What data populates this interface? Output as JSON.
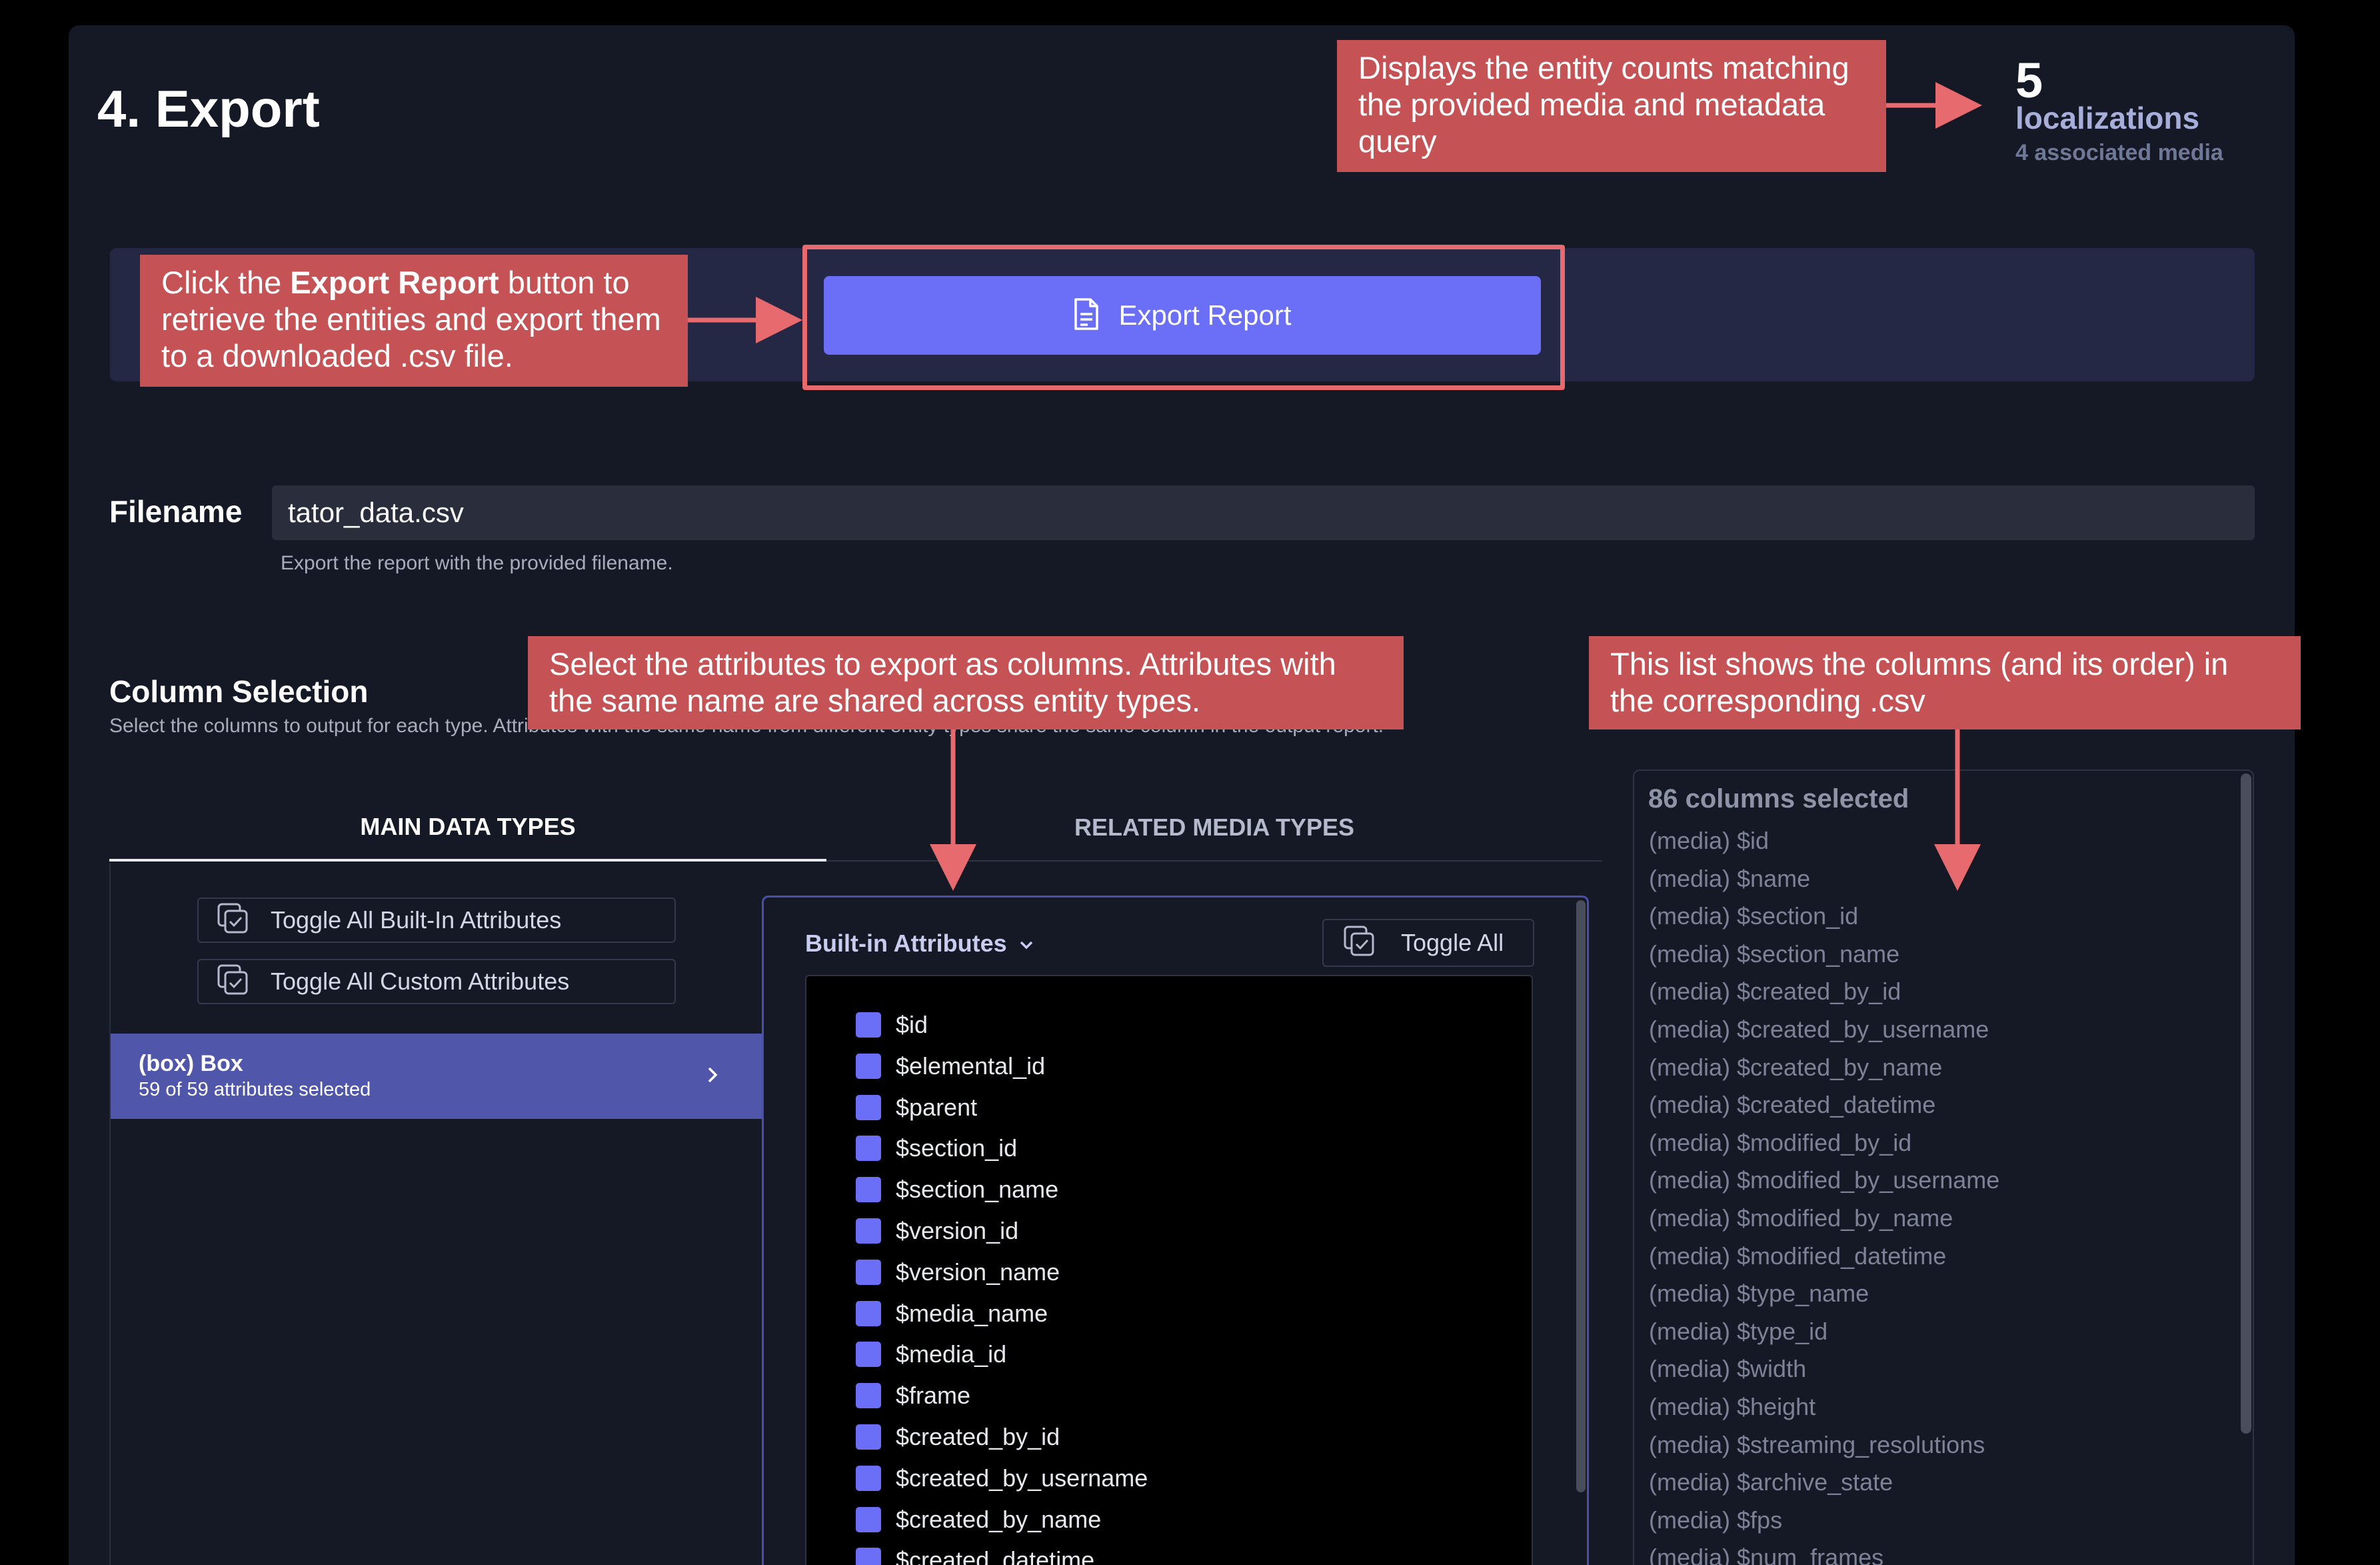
{
  "page": {
    "title": "4. Export"
  },
  "counts": {
    "number": "5",
    "label": "localizations",
    "sub": "4 associated media"
  },
  "export": {
    "button_label": "Export Report"
  },
  "filename": {
    "label": "Filename",
    "value": "tator_data.csv",
    "help": "Export the report with the provided filename."
  },
  "column_selection": {
    "title": "Column Selection",
    "description": "Select the columns to output for each type. Attributes with the same name from different entity types share the same column in the output report."
  },
  "tabs": {
    "main": "MAIN DATA TYPES",
    "related": "RELATED MEDIA TYPES"
  },
  "toggles": {
    "builtin": "Toggle All Built-In Attributes",
    "custom": "Toggle All Custom Attributes",
    "all": "Toggle All"
  },
  "box_item": {
    "name": "(box) Box",
    "sub": "59 of 59 attributes selected"
  },
  "builtin_header": "Built-in Attributes",
  "attributes": [
    "$id",
    "$elemental_id",
    "$parent",
    "$section_id",
    "$section_name",
    "$version_id",
    "$version_name",
    "$media_name",
    "$media_id",
    "$frame",
    "$created_by_id",
    "$created_by_username",
    "$created_by_name",
    "$created_datetime"
  ],
  "selected_columns": {
    "title": "86 columns selected",
    "items": [
      "(media) $id",
      "(media) $name",
      "(media) $section_id",
      "(media) $section_name",
      "(media) $created_by_id",
      "(media) $created_by_username",
      "(media) $created_by_name",
      "(media) $created_datetime",
      "(media) $modified_by_id",
      "(media) $modified_by_username",
      "(media) $modified_by_name",
      "(media) $modified_datetime",
      "(media) $type_name",
      "(media) $type_id",
      "(media) $width",
      "(media) $height",
      "(media) $streaming_resolutions",
      "(media) $archive_state",
      "(media) $fps",
      "(media) $num_frames"
    ]
  },
  "callouts": {
    "counts": "Displays the entity counts matching the provided media and metadata query",
    "export_pre": "Click the ",
    "export_bold": "Export Report",
    "export_post": " button to retrieve the entities and export them to a downloaded .csv file.",
    "attrs": "Select the attributes to export as columns. Attributes with the same name are shared across entity types.",
    "columns": "This list shows the columns (and its order) in the corresponding .csv"
  },
  "colors": {
    "accent": "#6b6ff7",
    "selected_item": "#5056a9",
    "callout": "#c55356",
    "highlight": "#e66a6e"
  },
  "icons": {
    "export": "document-icon",
    "toggle": "copy-check-icon",
    "chevron": "chevron-right-icon",
    "dropdown": "chevron-down-icon"
  }
}
